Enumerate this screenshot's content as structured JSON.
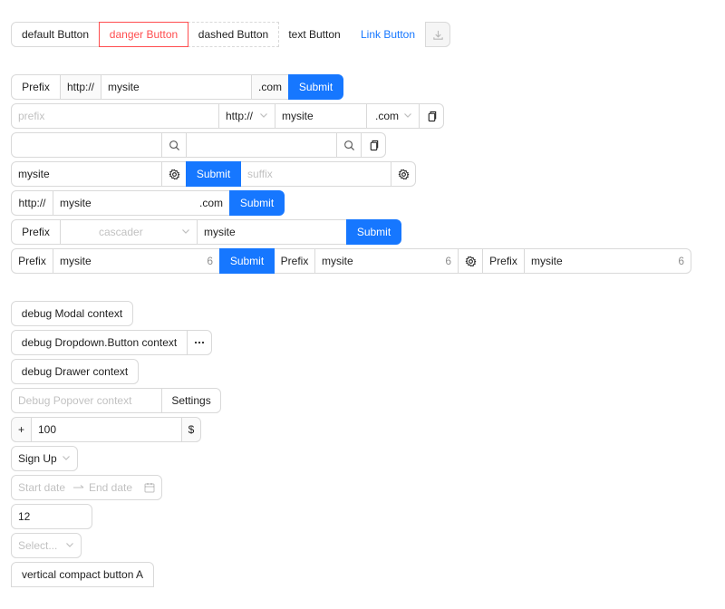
{
  "button_group": {
    "default": "default Button",
    "danger": "danger Button",
    "dashed": "dashed Button",
    "text": "text Button",
    "link": "Link Button"
  },
  "row1": {
    "prefix": "Prefix",
    "protocol": "http://",
    "value": "mysite",
    "suffix": ".com",
    "submit": "Submit"
  },
  "row2": {
    "placeholder": "prefix",
    "protocol": "http://",
    "value": "mysite",
    "suffix": ".com"
  },
  "row4": {
    "value": "mysite",
    "submit": "Submit",
    "suffix_placeholder": "suffix"
  },
  "row5": {
    "protocol": "http://",
    "value": "mysite",
    "suffix": ".com",
    "submit": "Submit"
  },
  "row6": {
    "prefix": "Prefix",
    "cascader_placeholder": "cascader",
    "value": "mysite",
    "submit": "Submit"
  },
  "row7": {
    "a": {
      "prefix": "Prefix",
      "value": "mysite",
      "count": "6",
      "submit": "Submit"
    },
    "b": {
      "prefix": "Prefix",
      "value": "mysite",
      "count": "6"
    },
    "c": {
      "prefix": "Prefix",
      "value": "mysite",
      "count": "6"
    }
  },
  "debug": {
    "modal": "debug Modal context",
    "dropdown": "debug Dropdown.Button context",
    "drawer": "debug Drawer context",
    "popover_placeholder": "Debug Popover context",
    "settings": "Settings"
  },
  "number": {
    "plus": "+",
    "value": "100",
    "unit": "$"
  },
  "signup": "Sign Up",
  "range": {
    "start": "Start date",
    "end": "End date"
  },
  "number2": "12",
  "select_placeholder": "Select...",
  "vertical_button": "vertical compact button A",
  "colors": {
    "primary": "#1677ff",
    "danger": "#ff4d4f",
    "border": "#d9d9d9"
  }
}
